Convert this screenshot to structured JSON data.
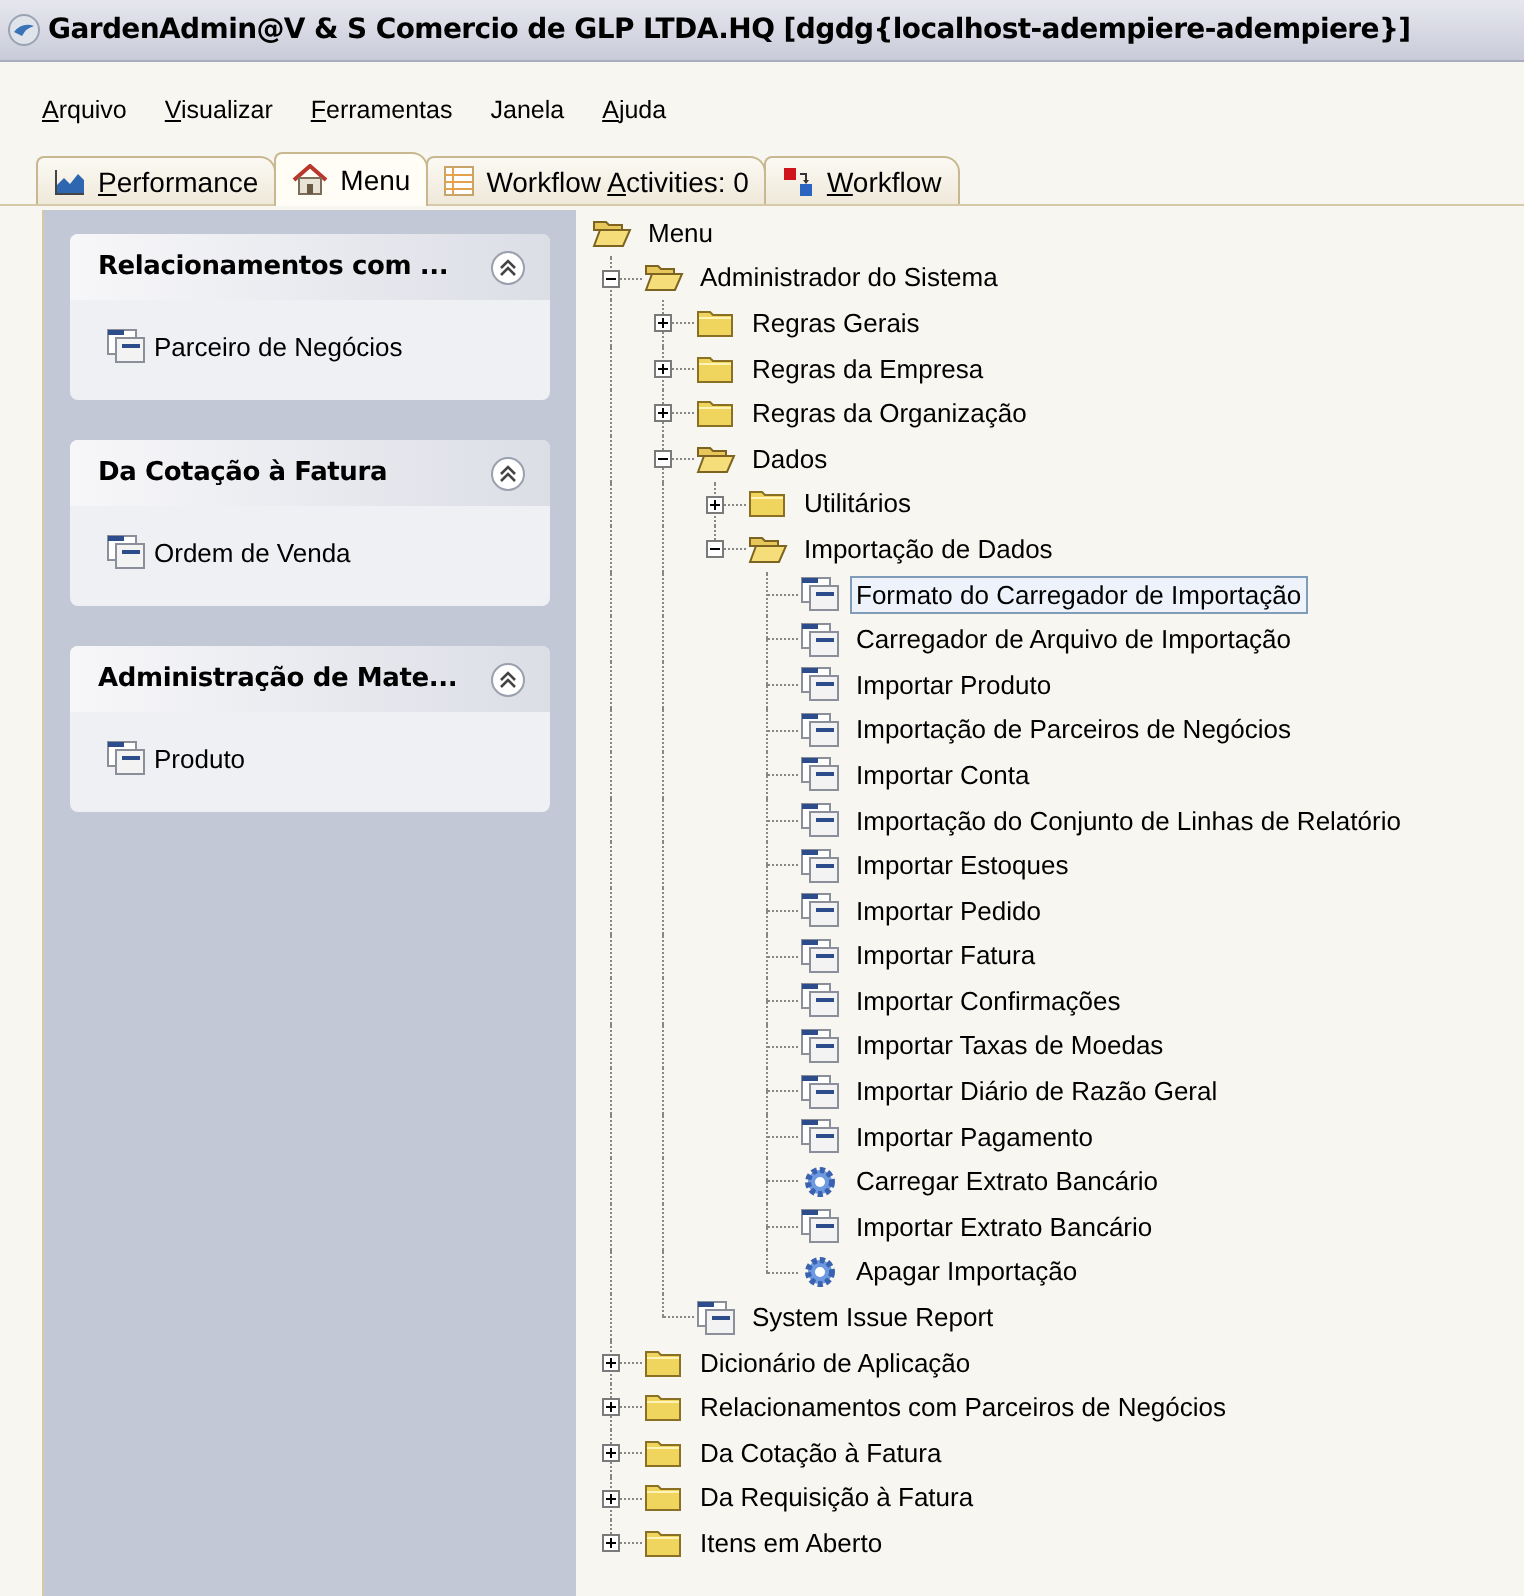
{
  "window": {
    "title": "GardenAdmin@V & S Comercio de GLP LTDA.HQ [dgdg{localhost-adempiere-adempiere}]"
  },
  "menu_bar": [
    {
      "mnemonic": "A",
      "label_rest": "rquivo"
    },
    {
      "mnemonic": "V",
      "label_rest": "isualizar"
    },
    {
      "mnemonic": "F",
      "label_rest": "erramentas"
    },
    {
      "label": "Janela"
    },
    {
      "mnemonic": "A",
      "label_rest": "juda"
    }
  ],
  "tabs": [
    {
      "mnemonic": "P",
      "label_rest": "erformance",
      "selected": false
    },
    {
      "label": "Menu",
      "selected": true
    },
    {
      "label": "Workflow ",
      "mnemonic": "A",
      "label_rest": "ctivities: 0",
      "selected": false
    },
    {
      "mnemonic": "W",
      "label_rest": "orkflow",
      "selected": false
    }
  ],
  "sidebar": [
    {
      "title": "Relacionamentos com ...",
      "items": [
        "Parceiro de Negócios"
      ]
    },
    {
      "title": "Da Cotação à Fatura",
      "items": [
        "Ordem de Venda"
      ]
    },
    {
      "title": "Administração de Mate...",
      "items": [
        "Produto"
      ]
    }
  ],
  "tree": {
    "label": "Menu",
    "kind": "folder",
    "selected": false,
    "children": [
      {
        "label": "Administrador do Sistema",
        "kind": "folder",
        "expanded": true,
        "selected": false,
        "children": [
          {
            "label": "Regras Gerais",
            "kind": "folder",
            "expanded": false,
            "selected": false
          },
          {
            "label": "Regras da Empresa",
            "kind": "folder",
            "expanded": false,
            "selected": false
          },
          {
            "label": "Regras da Organização",
            "kind": "folder",
            "expanded": false,
            "selected": false
          },
          {
            "label": "Dados",
            "kind": "folder",
            "expanded": true,
            "selected": false,
            "children": [
              {
                "label": "Utilitários",
                "kind": "folder",
                "expanded": false,
                "selected": false
              },
              {
                "label": "Importação de Dados",
                "kind": "folder",
                "expanded": true,
                "selected": false,
                "children": [
                  {
                    "label": "Formato do Carregador de Importação",
                    "kind": "window",
                    "selected": true
                  },
                  {
                    "label": "Carregador de Arquivo de Importação",
                    "kind": "window",
                    "selected": false
                  },
                  {
                    "label": "Importar Produto",
                    "kind": "window",
                    "selected": false
                  },
                  {
                    "label": "Importação de Parceiros de Negócios",
                    "kind": "window",
                    "selected": false
                  },
                  {
                    "label": "Importar Conta",
                    "kind": "window",
                    "selected": false
                  },
                  {
                    "label": "Importação do Conjunto de Linhas de Relatório",
                    "kind": "window",
                    "selected": false
                  },
                  {
                    "label": "Importar Estoques",
                    "kind": "window",
                    "selected": false
                  },
                  {
                    "label": "Importar Pedido",
                    "kind": "window",
                    "selected": false
                  },
                  {
                    "label": "Importar Fatura",
                    "kind": "window",
                    "selected": false
                  },
                  {
                    "label": "Importar Confirmações",
                    "kind": "window",
                    "selected": false
                  },
                  {
                    "label": "Importar Taxas de Moedas",
                    "kind": "window",
                    "selected": false
                  },
                  {
                    "label": "Importar Diário de Razão Geral",
                    "kind": "window",
                    "selected": false
                  },
                  {
                    "label": "Importar Pagamento",
                    "kind": "window",
                    "selected": false
                  },
                  {
                    "label": "Carregar Extrato Bancário",
                    "kind": "process",
                    "selected": false
                  },
                  {
                    "label": "Importar Extrato Bancário",
                    "kind": "window",
                    "selected": false
                  },
                  {
                    "label": "Apagar Importação",
                    "kind": "process",
                    "selected": false
                  }
                ]
              }
            ]
          },
          {
            "label": "System Issue Report",
            "kind": "window",
            "selected": false
          }
        ]
      },
      {
        "label": "Dicionário de Aplicação",
        "kind": "folder",
        "expanded": false,
        "selected": false
      },
      {
        "label": "Relacionamentos com Parceiros de Negócios",
        "kind": "folder",
        "expanded": false,
        "selected": false
      },
      {
        "label": "Da Cotação à Fatura",
        "kind": "folder",
        "expanded": false,
        "selected": false
      },
      {
        "label": "Da Requisição à Fatura",
        "kind": "folder",
        "expanded": false,
        "selected": false
      },
      {
        "label": "Itens em Aberto",
        "kind": "folder",
        "expanded": false,
        "selected": false
      }
    ]
  }
}
